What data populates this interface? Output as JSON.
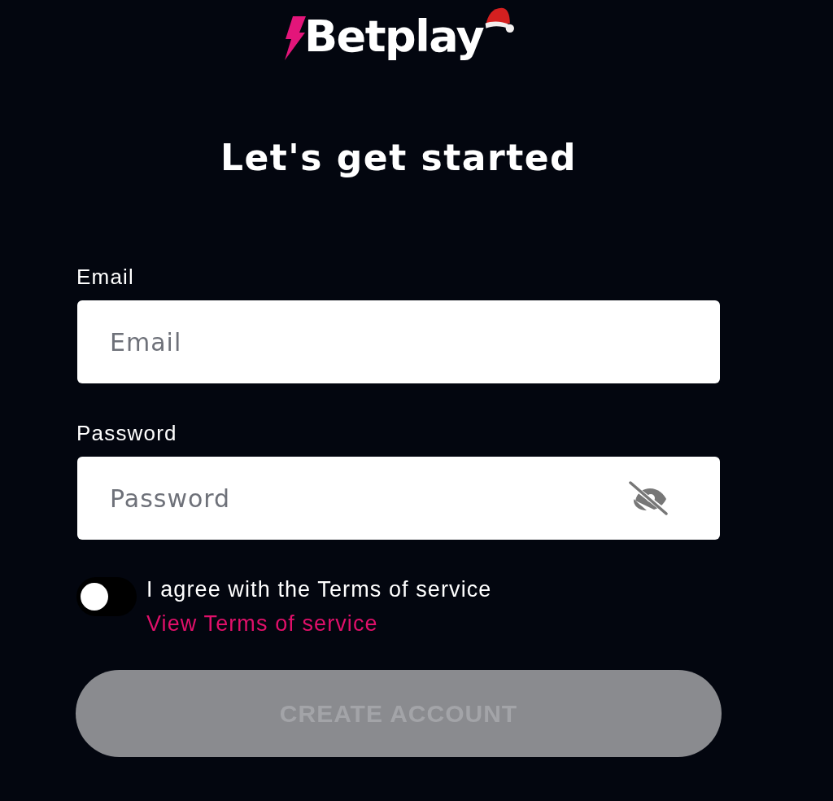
{
  "logo": {
    "text": "Betplay"
  },
  "heading": "Let's get started",
  "fields": [
    {
      "kind": "email",
      "label": "Email",
      "placeholder": "Email"
    },
    {
      "kind": "password",
      "label": "Password",
      "placeholder": "Password",
      "revealed": false
    }
  ],
  "terms": {
    "on": false,
    "text": "I agree with the Terms of service",
    "link": "View Terms of service"
  },
  "submit": {
    "label": "CREATE ACCOUNT",
    "disabled": true
  }
}
